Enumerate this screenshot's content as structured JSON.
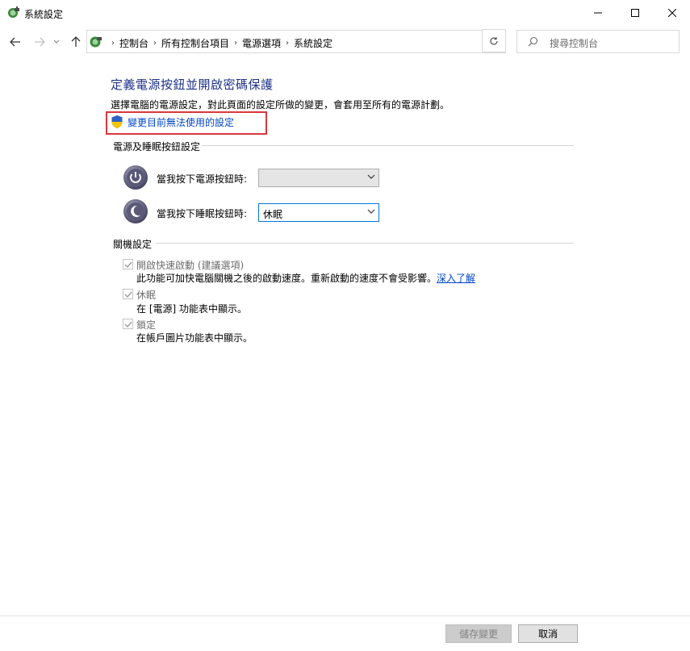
{
  "window": {
    "title": "系統設定",
    "app_icon": "power-options-icon"
  },
  "address_bar": {
    "breadcrumbs": [
      "控制台",
      "所有控制台項目",
      "電源選項",
      "系統設定"
    ],
    "search_placeholder": "搜尋控制台"
  },
  "content": {
    "heading": "定義電源按鈕並開啟密碼保護",
    "description": "選擇電腦的電源設定，對此頁面的設定所做的變更，會套用至所有的電源計劃。",
    "change_settings_link": "變更目前無法使用的設定",
    "power_section": {
      "title": "電源及睡眠按鈕設定",
      "rows": [
        {
          "label": "當我按下電源按鈕時:",
          "value": "",
          "icon": "power-button-icon"
        },
        {
          "label": "當我按下睡眠按鈕時:",
          "value": "休眠",
          "icon": "sleep-button-icon"
        }
      ]
    },
    "shutdown_section": {
      "title": "關機設定",
      "options": [
        {
          "label": "開啟快速啟動 (建議選項)",
          "checked": true,
          "desc": "此功能可加快電腦關機之後的啟動速度。重新啟動的速度不會受影響。",
          "link": "深入了解"
        },
        {
          "label": "休眠",
          "checked": true,
          "desc": "在 [電源] 功能表中顯示。",
          "link": ""
        },
        {
          "label": "鎖定",
          "checked": true,
          "desc": "在帳戶圖片功能表中顯示。",
          "link": ""
        }
      ]
    }
  },
  "footer": {
    "save_label": "儲存變更",
    "cancel_label": "取消"
  },
  "colors": {
    "heading": "#1e3287",
    "link": "#0046c8",
    "highlight": "#d9383c"
  }
}
